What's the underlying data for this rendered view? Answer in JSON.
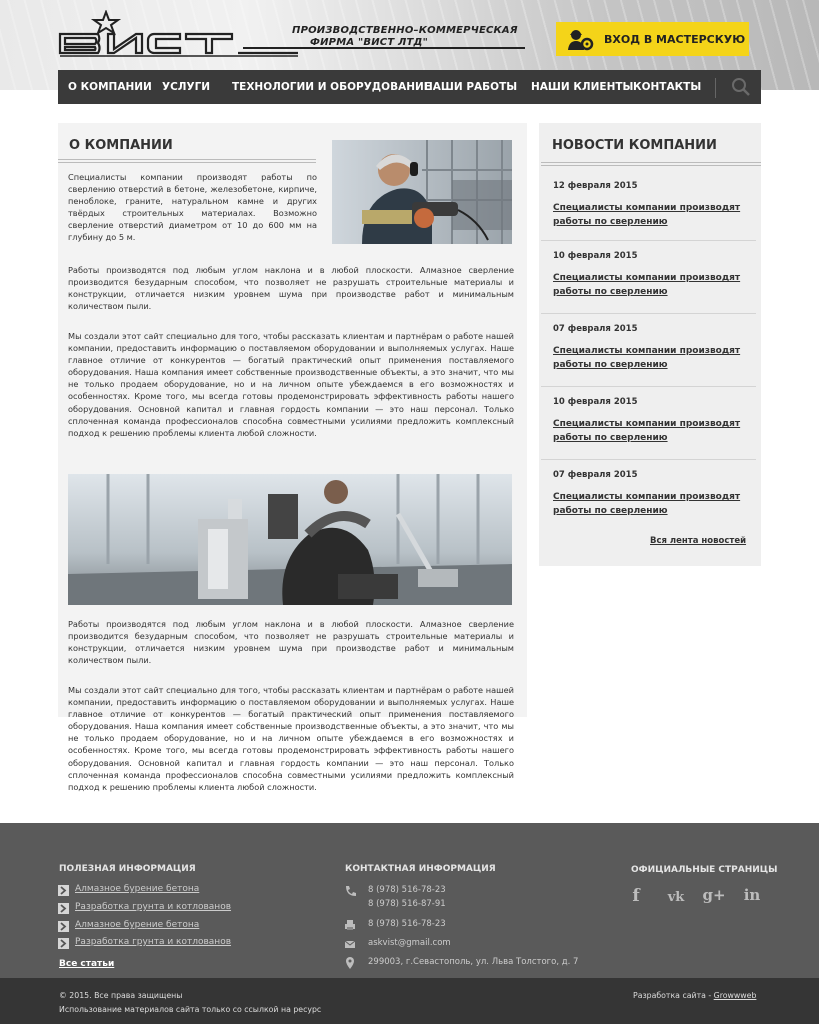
{
  "brand": {
    "logo_text": "ВИСТ",
    "tagline_line1": "ПРОИЗВОДСТВЕННО–КОММЕРЧЕСКАЯ",
    "tagline_line2": "ФИРМА \"ВИСТ ЛТД\"",
    "workshop_button": "ВХОД В МАСТЕРСКУЮ"
  },
  "nav": {
    "items": [
      "О КОМПАНИИ",
      "УСЛУГИ",
      "ТЕХНОЛОГИИ И ОБОРУДОВАНИЕ",
      "НАШИ РАБОТЫ",
      "НАШИ КЛИЕНТЫ",
      "КОНТАКТЫ"
    ],
    "search_icon": "search-icon"
  },
  "main": {
    "title": "О КОМПАНИИ",
    "intro": "Специалисты компании производят работы по сверлению отверстий в бетоне, железобетоне, кирпиче, пеноблоке, граните, натуральном камне и других твёрдых строительных материалах. Возможно сверление отверстий диаметром от 10 до 600 мм на глубину до 5 м.",
    "para1": "Работы производятся под любым углом наклона и в любой плоскости. Алмазное сверление производится безударным способом, что позволяет не разрушать строительные материалы и конструкции, отличается низким уровнем шума при производстве работ и минимальным количеством пыли.",
    "para2": "Мы создали этот сайт специально для того, чтобы рассказать клиентам и партнёрам о работе нашей компании, предоставить информацию о поставляемом оборудовании и выполняемых услугах. Наше главное отличие от конкурентов — богатый практический опыт применения поставляемого оборудования. Наша компания имеет собственные производственные объекты, а это значит, что мы не только продаем оборудование, но и на личном опыте убеждаемся в его возможностях и особенностях. Кроме того, мы всегда готовы продемонстрировать эффективность работы нашего оборудования. Основной капитал и главная гордость компании — это наш персонал. Только сплоченная команда профессионалов способна совместными усилиями предложить комплексный подход к решению проблемы клиента любой сложности.",
    "para3": "Работы производятся под любым углом наклона и в любой плоскости. Алмазное сверление производится безударным способом, что позволяет не разрушать строительные материалы и конструкции, отличается низким уровнем шума при производстве работ и минимальным количеством пыли.",
    "para4": "Мы создали этот сайт специально для того, чтобы рассказать клиентам и партнёрам о работе нашей компании, предоставить информацию о поставляемом оборудовании и выполняемых услугах. Наше главное отличие от конкурентов — богатый практический опыт применения поставляемого оборудования. Наша компания имеет собственные производственные объекты, а это значит, что мы не только продаем оборудование, но и на личном опыте убеждаемся в его возможностях и особенностях. Кроме того, мы всегда готовы продемонстрировать эффективность работы нашего оборудования. Основной капитал и главная гордость компании — это наш персонал. Только сплоченная команда профессионалов способна совместными усилиями предложить комплексный подход к решению проблемы клиента любой сложности."
  },
  "news": {
    "title": "НОВОСТИ КОМПАНИИ",
    "items": [
      {
        "date": "12 февраля 2015",
        "title": "Специалисты компании производят работы по сверлению"
      },
      {
        "date": "10 февраля 2015",
        "title": "Специалисты компании производят работы по сверлению"
      },
      {
        "date": "07 февраля 2015",
        "title": "Специалисты компании производят работы по сверлению"
      },
      {
        "date": "10 февраля 2015",
        "title": "Специалисты компании производят работы по сверлению"
      },
      {
        "date": "07 февраля 2015",
        "title": "Специалисты компании производят работы по сверлению"
      }
    ],
    "all_link": "Вся лента новостей"
  },
  "footer": {
    "useful_title": "ПОЛЕЗНАЯ ИНФОРМАЦИЯ",
    "useful_links": [
      "Алмазное бурение бетона",
      "Разработка грунта и котлованов",
      "Алмазное бурение бетона",
      "Разработка грунта и котлованов"
    ],
    "all_articles": "Все статьи",
    "contact_title": "КОНТАКТНАЯ ИНФОРМАЦИЯ",
    "phone1": "8 (978) 516-78-23",
    "phone2": "8 (978) 516-87-91",
    "fax": "8 (978) 516-78-23",
    "email": "askvist@gmail.com",
    "address": "299003, г.Севастополь, ул. Льва Толстого, д. 7",
    "social_title": "ОФИЦИАЛЬНЫЕ СТРАНИЦЫ",
    "social": [
      "f",
      "vk",
      "g+",
      "in"
    ],
    "copyright": "© 2015. Все права защищены",
    "usage_note": "Использование материалов сайта только со ссылкой на ресурс",
    "dev_label": "Разработка сайта - ",
    "dev_name": "Growwweb"
  }
}
